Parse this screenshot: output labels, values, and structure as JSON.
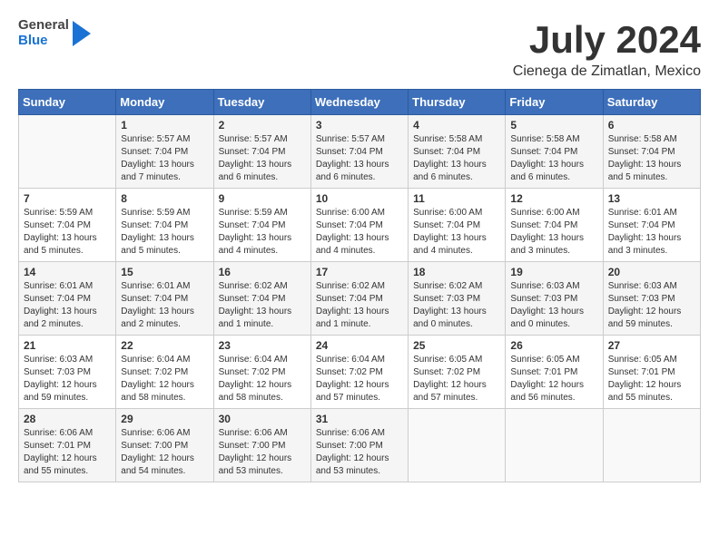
{
  "header": {
    "logo_general": "General",
    "logo_blue": "Blue",
    "month": "July 2024",
    "location": "Cienega de Zimatlan, Mexico"
  },
  "weekdays": [
    "Sunday",
    "Monday",
    "Tuesday",
    "Wednesday",
    "Thursday",
    "Friday",
    "Saturday"
  ],
  "weeks": [
    [
      {
        "day": "",
        "info": ""
      },
      {
        "day": "1",
        "info": "Sunrise: 5:57 AM\nSunset: 7:04 PM\nDaylight: 13 hours\nand 7 minutes."
      },
      {
        "day": "2",
        "info": "Sunrise: 5:57 AM\nSunset: 7:04 PM\nDaylight: 13 hours\nand 6 minutes."
      },
      {
        "day": "3",
        "info": "Sunrise: 5:57 AM\nSunset: 7:04 PM\nDaylight: 13 hours\nand 6 minutes."
      },
      {
        "day": "4",
        "info": "Sunrise: 5:58 AM\nSunset: 7:04 PM\nDaylight: 13 hours\nand 6 minutes."
      },
      {
        "day": "5",
        "info": "Sunrise: 5:58 AM\nSunset: 7:04 PM\nDaylight: 13 hours\nand 6 minutes."
      },
      {
        "day": "6",
        "info": "Sunrise: 5:58 AM\nSunset: 7:04 PM\nDaylight: 13 hours\nand 5 minutes."
      }
    ],
    [
      {
        "day": "7",
        "info": "Sunrise: 5:59 AM\nSunset: 7:04 PM\nDaylight: 13 hours\nand 5 minutes."
      },
      {
        "day": "8",
        "info": "Sunrise: 5:59 AM\nSunset: 7:04 PM\nDaylight: 13 hours\nand 5 minutes."
      },
      {
        "day": "9",
        "info": "Sunrise: 5:59 AM\nSunset: 7:04 PM\nDaylight: 13 hours\nand 4 minutes."
      },
      {
        "day": "10",
        "info": "Sunrise: 6:00 AM\nSunset: 7:04 PM\nDaylight: 13 hours\nand 4 minutes."
      },
      {
        "day": "11",
        "info": "Sunrise: 6:00 AM\nSunset: 7:04 PM\nDaylight: 13 hours\nand 4 minutes."
      },
      {
        "day": "12",
        "info": "Sunrise: 6:00 AM\nSunset: 7:04 PM\nDaylight: 13 hours\nand 3 minutes."
      },
      {
        "day": "13",
        "info": "Sunrise: 6:01 AM\nSunset: 7:04 PM\nDaylight: 13 hours\nand 3 minutes."
      }
    ],
    [
      {
        "day": "14",
        "info": "Sunrise: 6:01 AM\nSunset: 7:04 PM\nDaylight: 13 hours\nand 2 minutes."
      },
      {
        "day": "15",
        "info": "Sunrise: 6:01 AM\nSunset: 7:04 PM\nDaylight: 13 hours\nand 2 minutes."
      },
      {
        "day": "16",
        "info": "Sunrise: 6:02 AM\nSunset: 7:04 PM\nDaylight: 13 hours\nand 1 minute."
      },
      {
        "day": "17",
        "info": "Sunrise: 6:02 AM\nSunset: 7:04 PM\nDaylight: 13 hours\nand 1 minute."
      },
      {
        "day": "18",
        "info": "Sunrise: 6:02 AM\nSunset: 7:03 PM\nDaylight: 13 hours\nand 0 minutes."
      },
      {
        "day": "19",
        "info": "Sunrise: 6:03 AM\nSunset: 7:03 PM\nDaylight: 13 hours\nand 0 minutes."
      },
      {
        "day": "20",
        "info": "Sunrise: 6:03 AM\nSunset: 7:03 PM\nDaylight: 12 hours\nand 59 minutes."
      }
    ],
    [
      {
        "day": "21",
        "info": "Sunrise: 6:03 AM\nSunset: 7:03 PM\nDaylight: 12 hours\nand 59 minutes."
      },
      {
        "day": "22",
        "info": "Sunrise: 6:04 AM\nSunset: 7:02 PM\nDaylight: 12 hours\nand 58 minutes."
      },
      {
        "day": "23",
        "info": "Sunrise: 6:04 AM\nSunset: 7:02 PM\nDaylight: 12 hours\nand 58 minutes."
      },
      {
        "day": "24",
        "info": "Sunrise: 6:04 AM\nSunset: 7:02 PM\nDaylight: 12 hours\nand 57 minutes."
      },
      {
        "day": "25",
        "info": "Sunrise: 6:05 AM\nSunset: 7:02 PM\nDaylight: 12 hours\nand 57 minutes."
      },
      {
        "day": "26",
        "info": "Sunrise: 6:05 AM\nSunset: 7:01 PM\nDaylight: 12 hours\nand 56 minutes."
      },
      {
        "day": "27",
        "info": "Sunrise: 6:05 AM\nSunset: 7:01 PM\nDaylight: 12 hours\nand 55 minutes."
      }
    ],
    [
      {
        "day": "28",
        "info": "Sunrise: 6:06 AM\nSunset: 7:01 PM\nDaylight: 12 hours\nand 55 minutes."
      },
      {
        "day": "29",
        "info": "Sunrise: 6:06 AM\nSunset: 7:00 PM\nDaylight: 12 hours\nand 54 minutes."
      },
      {
        "day": "30",
        "info": "Sunrise: 6:06 AM\nSunset: 7:00 PM\nDaylight: 12 hours\nand 53 minutes."
      },
      {
        "day": "31",
        "info": "Sunrise: 6:06 AM\nSunset: 7:00 PM\nDaylight: 12 hours\nand 53 minutes."
      },
      {
        "day": "",
        "info": ""
      },
      {
        "day": "",
        "info": ""
      },
      {
        "day": "",
        "info": ""
      }
    ]
  ]
}
